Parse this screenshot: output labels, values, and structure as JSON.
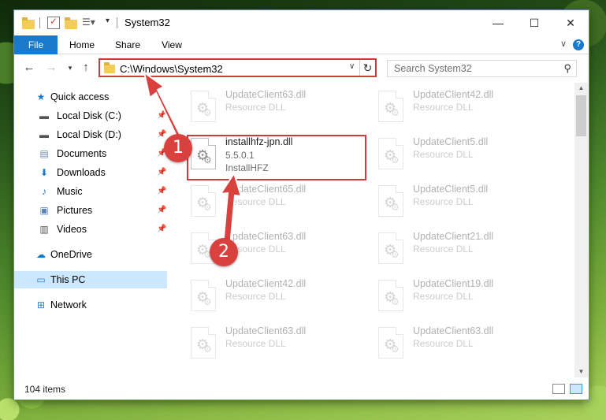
{
  "window": {
    "title": "System32",
    "tabs": [
      "File",
      "Home",
      "Share",
      "View"
    ],
    "help": "?"
  },
  "address": {
    "path": "C:\\Windows\\System32",
    "search_placeholder": "Search System32"
  },
  "sidebar": {
    "items": [
      {
        "label": "Quick access",
        "icon": "star-icon"
      },
      {
        "label": "Local Disk (C:)",
        "icon": "drive-icon"
      },
      {
        "label": "Local Disk (D:)",
        "icon": "drive-icon"
      },
      {
        "label": "Documents",
        "icon": "documents-icon"
      },
      {
        "label": "Downloads",
        "icon": "downloads-icon"
      },
      {
        "label": "Music",
        "icon": "music-icon"
      },
      {
        "label": "Pictures",
        "icon": "pictures-icon"
      },
      {
        "label": "Videos",
        "icon": "videos-icon"
      },
      {
        "label": "OneDrive",
        "icon": "onedrive-icon"
      },
      {
        "label": "This PC",
        "icon": "computer-icon"
      },
      {
        "label": "Network",
        "icon": "network-icon"
      }
    ]
  },
  "files": {
    "selected": {
      "name": "installhfz-jpn.dll",
      "version": "5.5.0.1",
      "company": "InstallHFZ"
    },
    "left_column": [
      {
        "name": "UpdateClient63.dll",
        "type": "Resource DLL"
      },
      {
        "name": "UpdateClient65.dll",
        "type": "Resource DLL"
      },
      {
        "name": "UpdateClient63.dll",
        "type": "Resource DLL"
      },
      {
        "name": "UpdateClient42.dll",
        "type": "Resource DLL"
      },
      {
        "name": "UpdateClient63.dll",
        "type": "Resource DLL"
      }
    ],
    "right_column": [
      {
        "name": "UpdateClient42.dll",
        "type": "Resource DLL"
      },
      {
        "name": "UpdateClient5.dll",
        "type": "Resource DLL"
      },
      {
        "name": "UpdateClient5.dll",
        "type": "Resource DLL"
      },
      {
        "name": "UpdateClient21.dll",
        "type": "Resource DLL"
      },
      {
        "name": "UpdateClient19.dll",
        "type": "Resource DLL"
      },
      {
        "name": "UpdateClient63.dll",
        "type": "Resource DLL"
      }
    ]
  },
  "status": {
    "item_count": "104 items"
  },
  "annotations": {
    "step1": "1",
    "step2": "2",
    "color": "#d9413f"
  }
}
